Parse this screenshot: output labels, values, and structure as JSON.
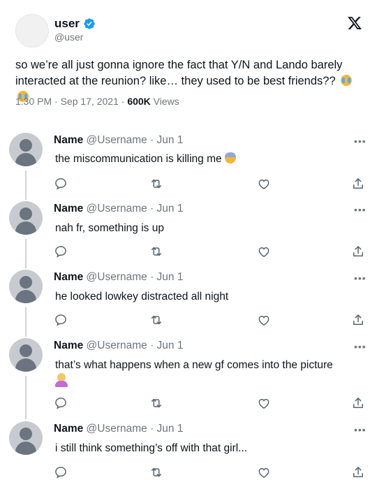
{
  "main_tweet": {
    "name": "user",
    "handle": "@user",
    "text": "so we’re all just gonna ignore the fact that Y/N and Lando barely interacted at the reunion? like… they used to be best friends??",
    "time": "1:30 PM · Sep 17, 2021 · ",
    "views_count": "600K",
    "views_label": " Views"
  },
  "replies": [
    {
      "name": "Name",
      "meta": "@Username · Jun 1",
      "text": "the miscommunication is killing me"
    },
    {
      "name": "Name",
      "meta": "@Username · Jun 1",
      "text": "nah fr, something is up"
    },
    {
      "name": "Name",
      "meta": "@Username · Jun 1",
      "text": "he looked lowkey distracted all night"
    },
    {
      "name": "Name",
      "meta": "@Username · Jun 1",
      "text": "that’s what happens when a new gf comes into the picture"
    },
    {
      "name": "Name",
      "meta": "@Username · Jun 1",
      "text": "i still think something’s off with that girl..."
    }
  ],
  "more_label": "•••",
  "icons": {
    "verified": "verified-badge-icon",
    "logo": "x-logo-icon",
    "reply": "comment-icon",
    "retweet": "retweet-icon",
    "like": "heart-icon",
    "share": "share-icon"
  },
  "colors": {
    "verified": "#1d9bf0",
    "muted": "#6e767d",
    "text": "#0f1419"
  }
}
